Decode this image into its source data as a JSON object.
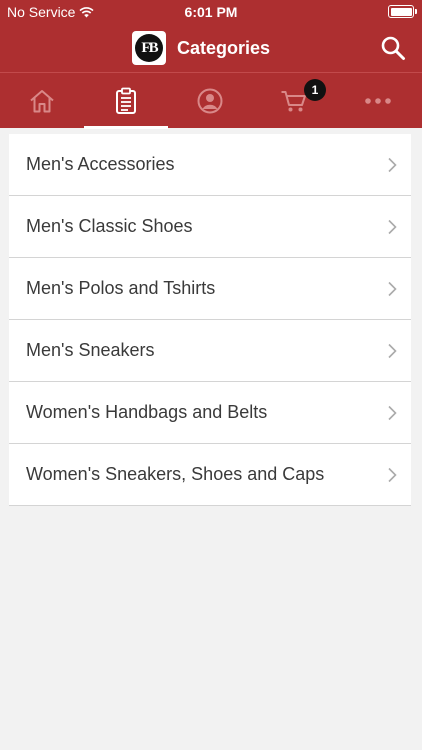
{
  "status_bar": {
    "carrier": "No Service",
    "time": "6:01 PM"
  },
  "nav_bar": {
    "logo_text": "FB",
    "title": "Categories"
  },
  "tabs": [
    {
      "name": "home",
      "icon": "home-icon"
    },
    {
      "name": "categories",
      "icon": "clipboard-icon",
      "active": true
    },
    {
      "name": "account",
      "icon": "user-icon"
    },
    {
      "name": "cart",
      "icon": "cart-icon",
      "badge": "1"
    },
    {
      "name": "more",
      "icon": "more-icon"
    }
  ],
  "categories": [
    "Men's Accessories",
    "Men's Classic Shoes",
    "Men's Polos and Tshirts",
    "Men's Sneakers",
    "Women's Handbags and Belts",
    "Women's Sneakers, Shoes and Caps"
  ],
  "colors": {
    "header": "#ad2f30",
    "tab_icon": "#d98888",
    "background": "#f2f2f2"
  }
}
